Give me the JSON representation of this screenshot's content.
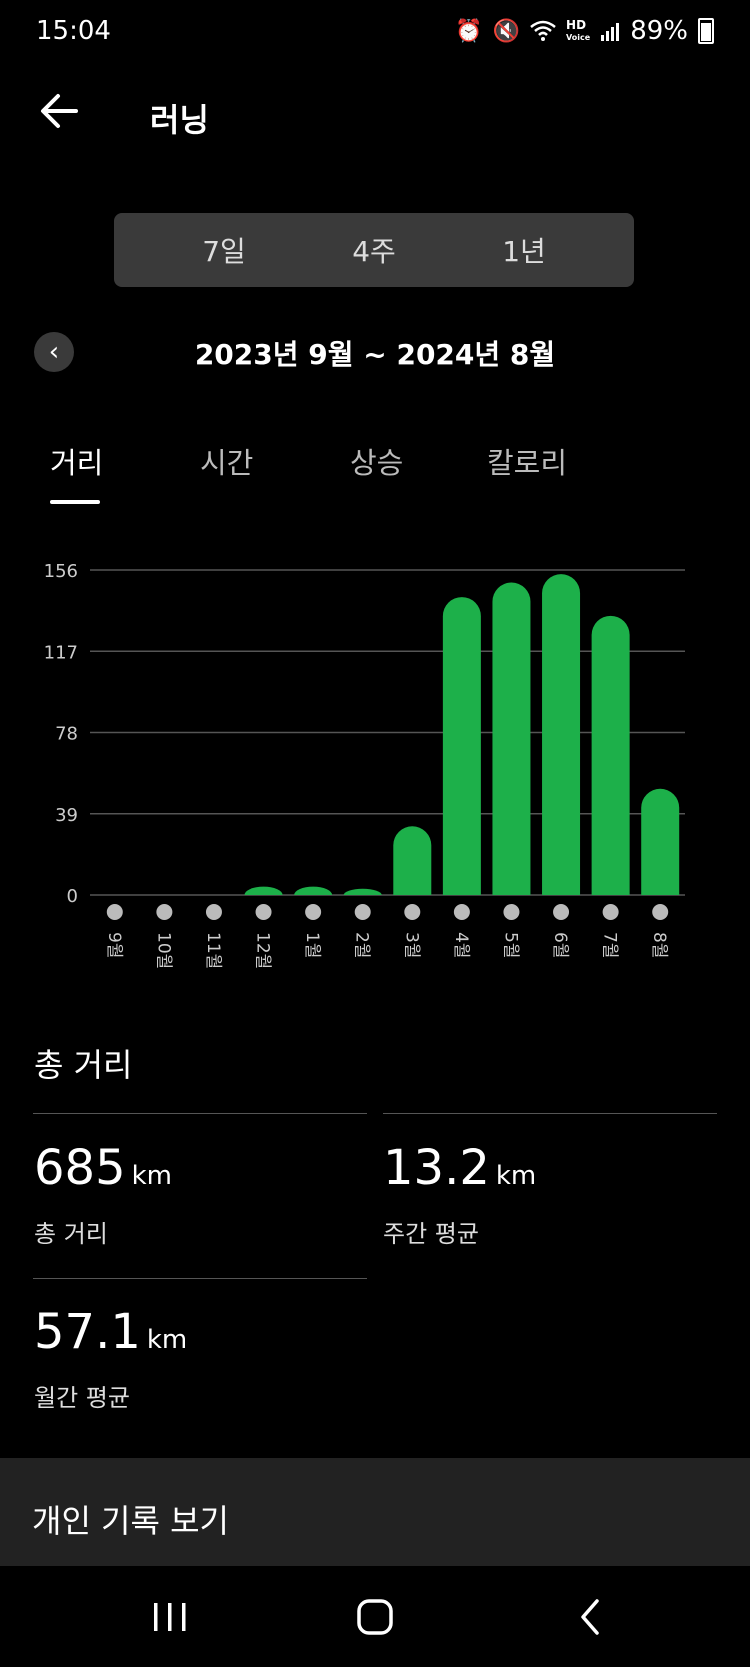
{
  "status_bar": {
    "time": "15:04",
    "battery": "89%",
    "icons": [
      "alarm-icon",
      "mute-icon",
      "wifi-icon",
      "hd-voice-icon",
      "signal-icon",
      "battery-icon"
    ]
  },
  "header": {
    "title": "러닝",
    "back_icon": "arrow-left-icon"
  },
  "period_tabs": [
    {
      "label": "7일"
    },
    {
      "label": "4주"
    },
    {
      "label": "1년"
    }
  ],
  "range": {
    "label": "2023년 9월 ~ 2024년 8월",
    "prev_icon": "chevron-left-icon"
  },
  "metric_tabs": [
    {
      "label": "거리",
      "active": true
    },
    {
      "label": "시간"
    },
    {
      "label": "상승"
    },
    {
      "label": "칼로리"
    }
  ],
  "accent_color": "#1DB04A",
  "chart_data": {
    "type": "bar",
    "categories": [
      "9월",
      "10월",
      "11월",
      "12월",
      "1월",
      "2월",
      "3월",
      "4월",
      "5월",
      "6월",
      "7월",
      "8월"
    ],
    "values": [
      0,
      0,
      0,
      4,
      4,
      3,
      33,
      143,
      150,
      154,
      134,
      51
    ],
    "yticks": [
      0,
      39,
      78,
      117,
      156
    ],
    "ylim": [
      0,
      156
    ],
    "grid": true,
    "bar_color": "#1DB04A"
  },
  "summary": {
    "title": "총 거리",
    "total": {
      "value": "685",
      "unit": "km",
      "label": "총 거리"
    },
    "weekly_avg": {
      "value": "13.2",
      "unit": "km",
      "label": "주간 평균"
    },
    "monthly_avg": {
      "value": "57.1",
      "unit": "km",
      "label": "월간 평균"
    }
  },
  "records": {
    "label": "개인 기록 보기"
  },
  "nav": {
    "icons": [
      "recent-apps-icon",
      "home-icon",
      "back-icon"
    ]
  }
}
